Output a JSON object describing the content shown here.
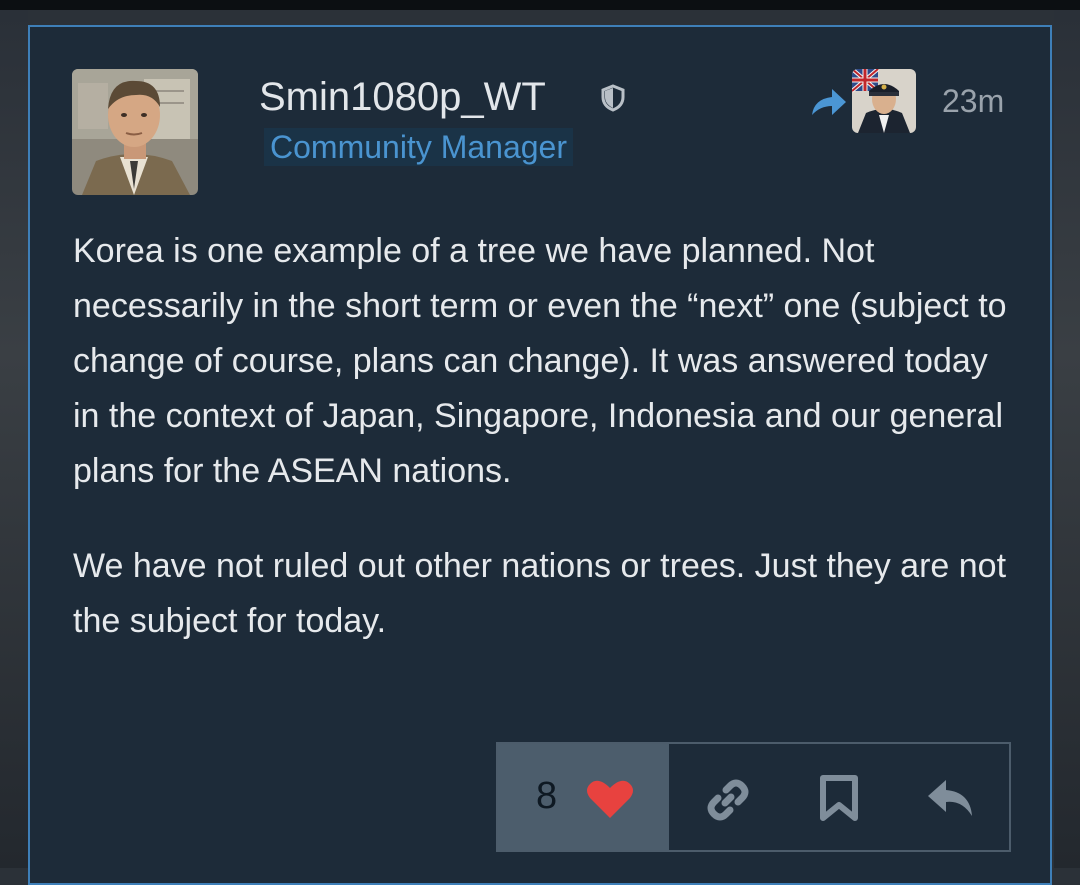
{
  "post": {
    "username": "Smin1080p_WT",
    "role": "Community Manager",
    "time": "23m",
    "paragraphs": [
      "Korea is one example of a tree we have planned. Not necessarily in the short term or even the “next” one (subject to change of course, plans can change). It was answered today in the context of Japan, Singapore, Indonesia and our general plans for the ASEAN nations.",
      "We have not ruled out other nations or trees. Just they are not the subject for today."
    ]
  },
  "actions": {
    "like_count": "8",
    "icons": [
      "heart-icon",
      "link-icon",
      "bookmark-icon",
      "reply-icon"
    ]
  },
  "header_icons": [
    "shield-icon",
    "reply-arrow-icon",
    "reply-to-avatar"
  ],
  "colors": {
    "post_background": "#1d2b39",
    "post_border": "#3e7fb8",
    "role_text": "#4a94d0",
    "heart": "#e8423f",
    "like_background": "#4c5d6c"
  }
}
